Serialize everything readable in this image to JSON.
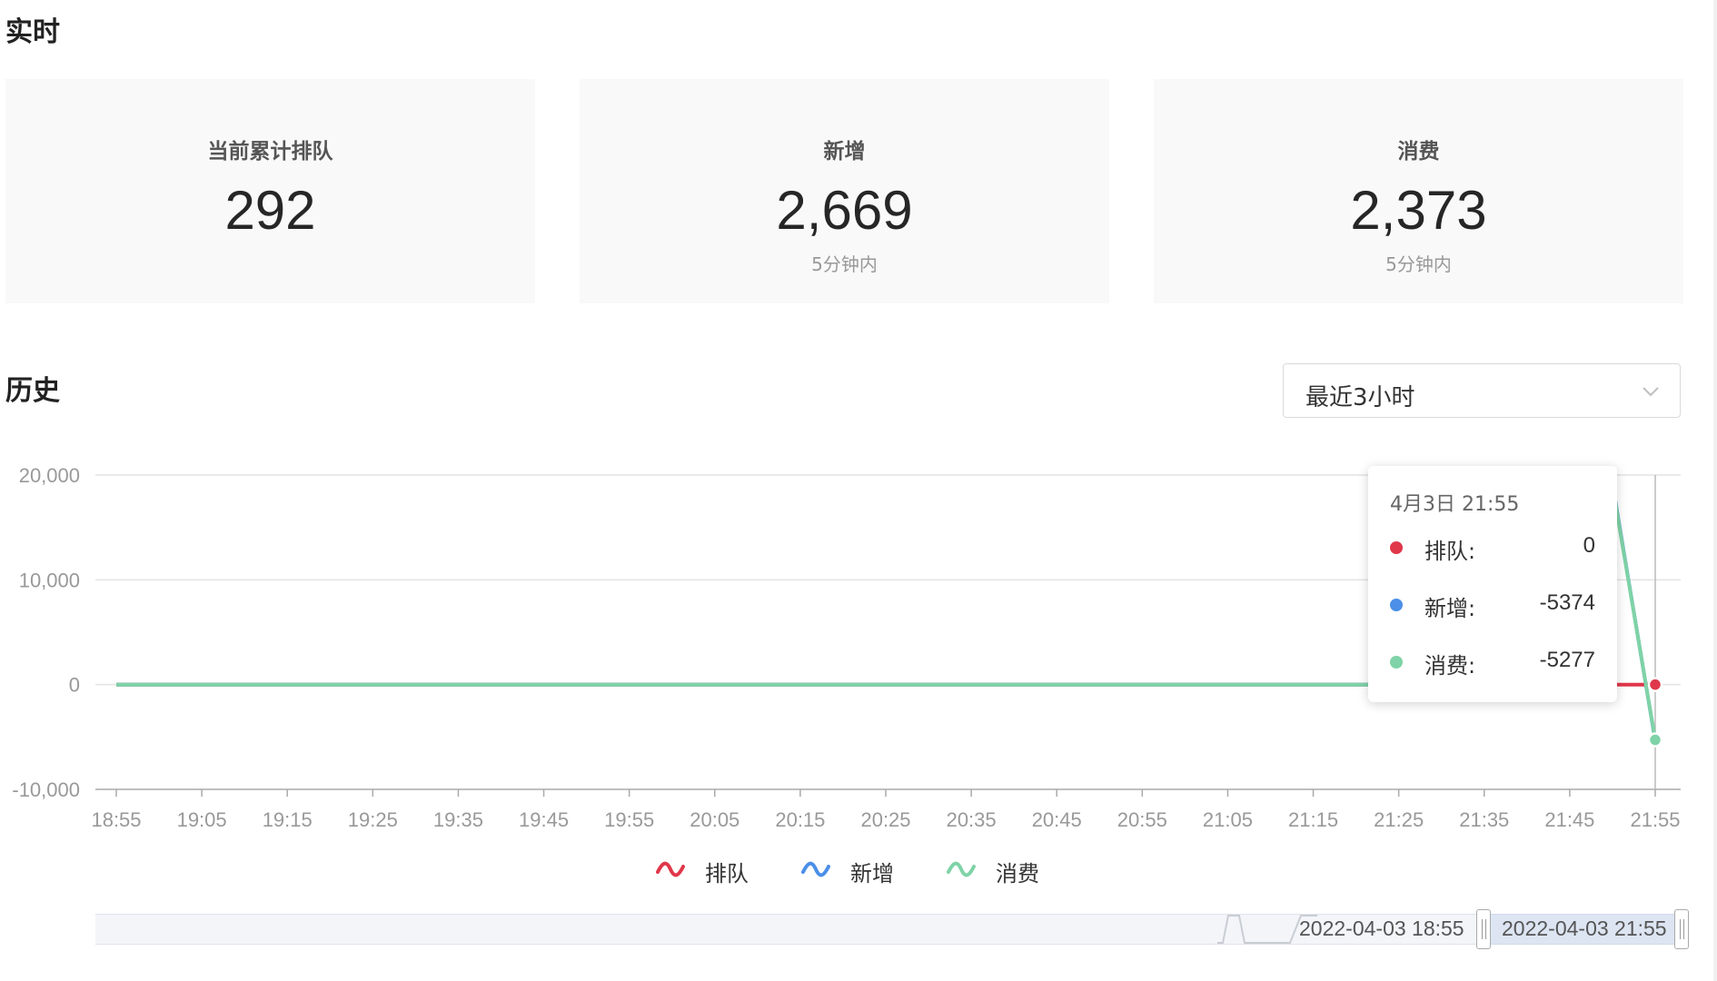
{
  "sections": {
    "realtime": "实时",
    "history": "历史"
  },
  "cards": [
    {
      "label": "当前累计排队",
      "value": "292",
      "sub": ""
    },
    {
      "label": "新增",
      "value": "2,669",
      "sub": "5分钟内"
    },
    {
      "label": "消费",
      "value": "2,373",
      "sub": "5分钟内"
    }
  ],
  "range_select": {
    "value": "最近3小时",
    "icon": "chevron-down-icon"
  },
  "colors": {
    "queue": "#e0374a",
    "added": "#4b8fe8",
    "consumed": "#7fd3a6"
  },
  "chart_data": {
    "type": "line",
    "x": [
      "18:55",
      "19:05",
      "19:15",
      "19:25",
      "19:35",
      "19:45",
      "19:55",
      "20:05",
      "20:15",
      "20:25",
      "20:35",
      "20:45",
      "20:55",
      "21:05",
      "21:15",
      "21:25",
      "21:35",
      "21:45",
      "21:50",
      "21:55"
    ],
    "x_ticks": [
      "18:55",
      "19:05",
      "19:15",
      "19:25",
      "19:35",
      "19:45",
      "19:55",
      "20:05",
      "20:15",
      "20:25",
      "20:35",
      "20:45",
      "20:55",
      "21:05",
      "21:15",
      "21:25",
      "21:35",
      "21:45",
      "21:55"
    ],
    "y_ticks": [
      "20,000",
      "10,000",
      "0",
      "-10,000"
    ],
    "ylim": [
      -10000,
      20000
    ],
    "series": [
      {
        "name": "排队",
        "values": [
          0,
          0,
          0,
          0,
          0,
          0,
          0,
          0,
          0,
          0,
          0,
          0,
          0,
          0,
          0,
          0,
          0,
          0,
          0,
          0
        ]
      },
      {
        "name": "新增",
        "values": [
          0,
          0,
          0,
          0,
          0,
          0,
          0,
          0,
          0,
          0,
          0,
          0,
          0,
          0,
          0,
          0,
          0,
          0,
          19200,
          -5374
        ]
      },
      {
        "name": "消费",
        "values": [
          0,
          0,
          0,
          0,
          0,
          0,
          0,
          0,
          0,
          0,
          0,
          0,
          0,
          0,
          0,
          0,
          0,
          0,
          19000,
          -5277
        ]
      }
    ],
    "grid": true,
    "legend_position": "bottom-center"
  },
  "tooltip": {
    "title": "4月3日 21:55",
    "rows": [
      {
        "name": "排队:",
        "value": "0"
      },
      {
        "name": "新增:",
        "value": "-5374"
      },
      {
        "name": "消费:",
        "value": "-5277"
      }
    ]
  },
  "range_slider": {
    "start_label": "2022-04-03 18:55",
    "end_label": "2022-04-03 21:55"
  }
}
